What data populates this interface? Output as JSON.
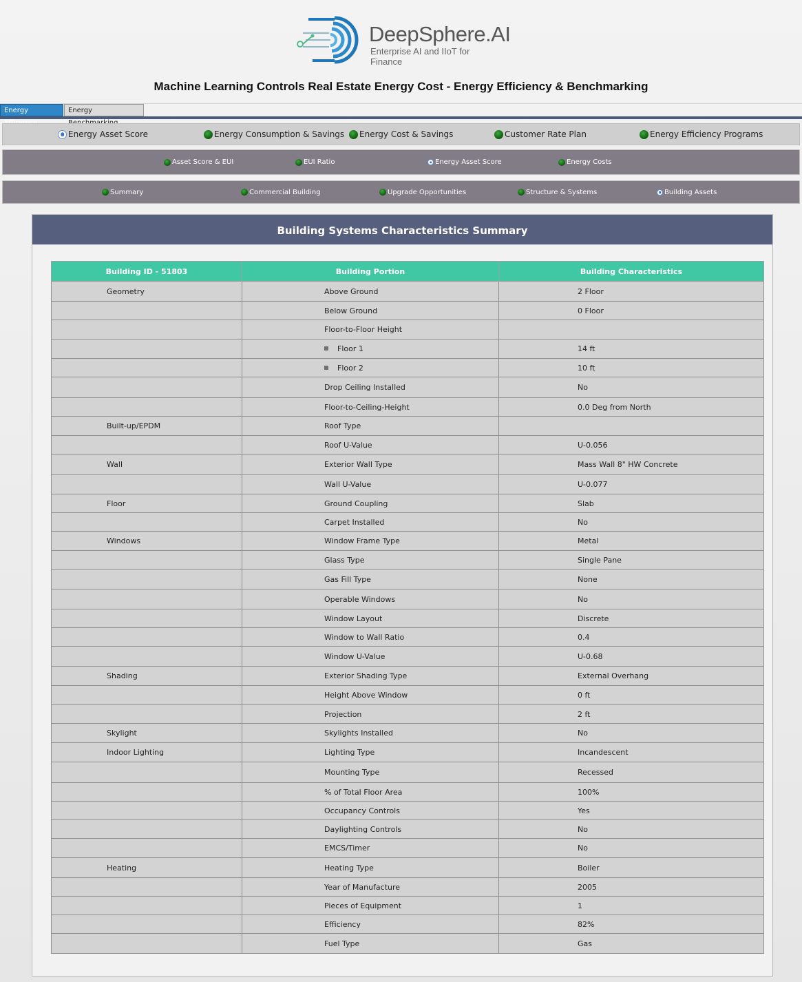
{
  "brand": {
    "name": "DeepSphere.AI",
    "tagline": "Enterprise AI and IIoT for Finance",
    "logo_icon": "concentric-d-circuit-logo",
    "accent": "#2f86c8"
  },
  "page": {
    "title": "Machine Learning Controls Real Estate Energy Cost - Energy Efficiency & Benchmarking"
  },
  "tabs": [
    {
      "label": "Energy Efficiency",
      "active": true
    },
    {
      "label": "Energy Benchmarking",
      "active": false
    }
  ],
  "nav_primary": [
    {
      "label": "Energy Asset Score",
      "selected": true
    },
    {
      "label": "Energy Consumption & Savings",
      "selected": false
    },
    {
      "label": "Energy Cost & Savings",
      "selected": false
    },
    {
      "label": "Customer Rate Plan",
      "selected": false
    },
    {
      "label": "Energy Efficiency Programs",
      "selected": false
    }
  ],
  "nav_secondary": [
    {
      "label": "Asset Score & EUI",
      "selected": false
    },
    {
      "label": "EUI Ratio",
      "selected": false
    },
    {
      "label": "Energy Asset Score",
      "selected": true
    },
    {
      "label": "Energy Costs",
      "selected": false
    }
  ],
  "nav_tertiary": [
    {
      "label": "Summary",
      "selected": false
    },
    {
      "label": "Commercial Building",
      "selected": false
    },
    {
      "label": "Upgrade Opportunities",
      "selected": false
    },
    {
      "label": "Structure & Systems",
      "selected": false
    },
    {
      "label": "Building Assets",
      "selected": true
    }
  ],
  "panel": {
    "title": "Building Systems Characteristics Summary"
  },
  "table": {
    "headers": [
      "Building ID - 51803",
      "Building Portion",
      "Building Characteristics"
    ],
    "rows": [
      {
        "category": "Geometry",
        "portion": "Above Ground",
        "value": "2 Floor"
      },
      {
        "category": "",
        "portion": "Below Ground",
        "value": "0 Floor"
      },
      {
        "category": "",
        "portion": "Floor-to-Floor Height",
        "value": ""
      },
      {
        "category": "",
        "portion": "Floor 1",
        "value": "14 ft",
        "bullet": true
      },
      {
        "category": "",
        "portion": "Floor 2",
        "value": "10 ft",
        "bullet": true
      },
      {
        "category": "",
        "portion": "Drop Ceiling Installed",
        "value": "No"
      },
      {
        "category": "",
        "portion": "Floor-to-Ceiling-Height",
        "value": "0.0 Deg from North"
      },
      {
        "category": "Built-up/EPDM",
        "portion": "Roof Type",
        "value": ""
      },
      {
        "category": "",
        "portion": "Roof U-Value",
        "value": "U-0.056"
      },
      {
        "category": "Wall",
        "portion": "Exterior Wall Type",
        "value": "Mass Wall 8\" HW Concrete"
      },
      {
        "category": "",
        "portion": "Wall U-Value",
        "value": "U-0.077"
      },
      {
        "category": "Floor",
        "portion": "Ground Coupling",
        "value": "Slab"
      },
      {
        "category": "",
        "portion": "Carpet Installed",
        "value": "No"
      },
      {
        "category": "Windows",
        "portion": "Window Frame Type",
        "value": "Metal"
      },
      {
        "category": "",
        "portion": "Glass Type",
        "value": "Single Pane"
      },
      {
        "category": "",
        "portion": "Gas Fill Type",
        "value": "None"
      },
      {
        "category": "",
        "portion": "Operable Windows",
        "value": "No"
      },
      {
        "category": "",
        "portion": "Window Layout",
        "value": "Discrete"
      },
      {
        "category": "",
        "portion": "Window to Wall Ratio",
        "value": "0.4"
      },
      {
        "category": "",
        "portion": "Window U-Value",
        "value": "U-0.68"
      },
      {
        "category": "Shading",
        "portion": "Exterior Shading Type",
        "value": "External Overhang"
      },
      {
        "category": "",
        "portion": "Height Above Window",
        "value": "0 ft"
      },
      {
        "category": "",
        "portion": "Projection",
        "value": "2 ft"
      },
      {
        "category": "Skylight",
        "portion": "Skylights Installed",
        "value": "No"
      },
      {
        "category": "Indoor Lighting",
        "portion": "Lighting Type",
        "value": "Incandescent"
      },
      {
        "category": "",
        "portion": "Mounting Type",
        "value": "Recessed"
      },
      {
        "category": "",
        "portion": "% of Total Floor Area",
        "value": "100%"
      },
      {
        "category": "",
        "portion": "Occupancy Controls",
        "value": "Yes"
      },
      {
        "category": "",
        "portion": "Daylighting Controls",
        "value": "No"
      },
      {
        "category": "",
        "portion": "EMCS/Timer",
        "value": "No"
      },
      {
        "category": "Heating",
        "portion": "Heating Type",
        "value": "Boiler"
      },
      {
        "category": "",
        "portion": "Year of Manufacture",
        "value": "2005"
      },
      {
        "category": "",
        "portion": "Pieces of Equipment",
        "value": "1"
      },
      {
        "category": "",
        "portion": "Efficiency",
        "value": "82%"
      },
      {
        "category": "",
        "portion": "Fuel Type",
        "value": "Gas"
      }
    ]
  }
}
